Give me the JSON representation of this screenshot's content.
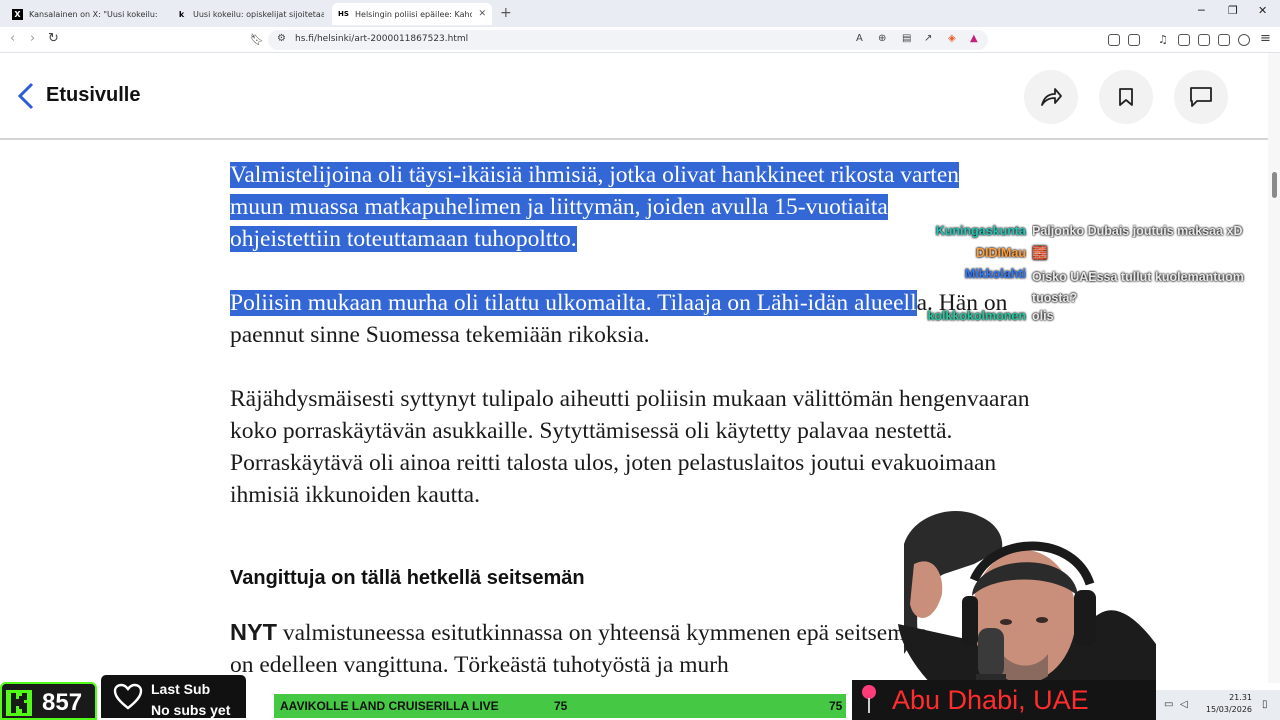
{
  "browser": {
    "tabs": [
      {
        "favicon": "X",
        "title": "Kansalainen on X: \"Uusi kokeilu: opiskelijat\"",
        "active": false
      },
      {
        "favicon": "k",
        "title": "Uusi kokeilu: opiskelijat sijoitetaan m",
        "active": false
      },
      {
        "favicon": "HS",
        "title": "Helsingin poliisi epäilee: Kahdelle",
        "active": true
      }
    ],
    "url": "hs.fi/helsinki/art-2000011867523.html",
    "icons": {
      "back": "back-arrow-icon",
      "forward": "forward-arrow-icon",
      "reload": "reload-icon",
      "bookmark": "bookmark-icon",
      "site_info": "site-info-icon",
      "translate": "translate-icon",
      "zoom": "zoom-icon",
      "reader": "reader-icon",
      "share": "share-icon",
      "brave_shield": "brave-shield-icon",
      "brave_rewards": "brave-rewards-icon"
    }
  },
  "site": {
    "back_label": "Etusivulle",
    "share_icon": "share-icon",
    "bookmark_icon": "bookmark-icon",
    "comment_icon": "comment-icon"
  },
  "article": {
    "para1": "Valmistelijoina oli täysi-ikäisiä ihmisiä, jotka olivat hankkineet rikosta varten muun muassa matkapuhelimen ja liittymän, joiden avulla 15-vuotiaita ohjeistettiin toteuttamaan tuhopoltto.",
    "para2_selected": "Poliisin mukaan murha oli tilattu ulkomailta. Tilaaja on Lähi-idän alueell",
    "para2_rest": "a. Hän on paennut sinne Suomessa tekemiään rikoksia.",
    "para3": "Räjähdysmäisesti syttynyt tulipalo aiheutti poliisin mukaan välittömän hengenvaaran koko porraskäytävän asukkaille. Sytyttämisessä oli käytetty palavaa nestettä. Porraskäytävä oli ainoa reitti talosta ulos, joten pelastuslaitos joutui evakuoimaan ihmisiä ikkunoiden kautta.",
    "subheading": "Vangittuja on tällä hetkellä seitsemän",
    "para4_lead": "NYT",
    "para4": " valmistuneessa esitutkinnassa on yhteensä kymmenen epä seitsemän on edelleen vangittuna. Törkeästä tuhotyöstä ja murh"
  },
  "chat": [
    {
      "user": "Kuningaskunta",
      "color": "#21c7b7",
      "message": "Paljonko Dubais joutuis maksaa xD"
    },
    {
      "user": "DIDIMau",
      "color": "#ff9d3b",
      "message": "🧱"
    },
    {
      "user": "Mikkolahti",
      "color": "#2f7bff",
      "message": "Oisko UAEssa tullut kuolemantuom tuosta?"
    },
    {
      "user": "kolkkokolmonen",
      "color": "#22c9a0",
      "message": "olis"
    }
  ],
  "stream": {
    "kick_count": "857",
    "last_sub_title": "Last Sub",
    "last_sub_value": "No subs yet",
    "goal_text": "AAVIKOLLE LAND CRUISERILLA LIVE",
    "goal_current": "75",
    "goal_target": "75",
    "goal_progress": 1.0,
    "location": "Abu Dhabi, UAE",
    "location_icon": "map-pin-icon",
    "kick_color": "#53fc18"
  },
  "taskbar": {
    "time": "21.31",
    "date": "15/03/2026"
  }
}
